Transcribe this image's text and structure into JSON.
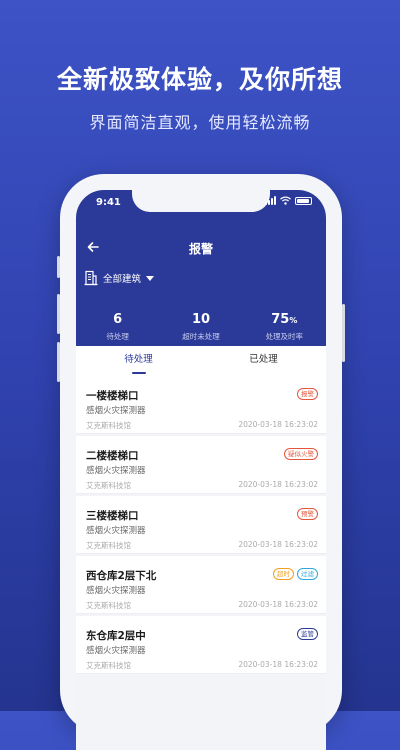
{
  "promo": {
    "headline": "全新极致体验，及你所想",
    "subline": "界面简洁直观，使用轻松流畅"
  },
  "status_bar": {
    "time": "9:41"
  },
  "header": {
    "title": "报警",
    "building_filter": "全部建筑"
  },
  "stats": [
    {
      "value": "6",
      "label": "待处理"
    },
    {
      "value": "10",
      "label": "超时未处理"
    },
    {
      "value": "75",
      "unit": "%",
      "label": "处理及时率"
    }
  ],
  "tabs": [
    {
      "label": "待处理",
      "active": true
    },
    {
      "label": "已处理",
      "active": false
    }
  ],
  "alarms": [
    {
      "title": "一楼楼梯口",
      "device": "感烟火灾探测器",
      "org": "艾克斯科技馆",
      "time": "2020-03-18 16:23:02",
      "badges": [
        {
          "text": "报警",
          "color": "#e4573c"
        }
      ]
    },
    {
      "title": "二楼楼梯口",
      "device": "感烟火灾探测器",
      "org": "艾克斯科技馆",
      "time": "2020-03-18 16:23:02",
      "badges": [
        {
          "text": "疑似火警",
          "color": "#e4573c"
        }
      ]
    },
    {
      "title": "三楼楼梯口",
      "device": "感烟火灾探测器",
      "org": "艾克斯科技馆",
      "time": "2020-03-18 16:23:02",
      "badges": [
        {
          "text": "预警",
          "color": "#e4573c"
        }
      ]
    },
    {
      "title": "西仓库2层下北",
      "device": "感烟火灾探测器",
      "org": "艾克斯科技馆",
      "time": "2020-03-18 16:23:02",
      "badges": [
        {
          "text": "超时",
          "color": "#f0a020"
        },
        {
          "text": "过滤",
          "color": "#2fa7d8"
        }
      ]
    },
    {
      "title": "东仓库2层中",
      "device": "感烟火灾探测器",
      "org": "艾克斯科技馆",
      "time": "2020-03-18 16:23:02",
      "badges": [
        {
          "text": "监管",
          "color": "#2b3a98"
        }
      ]
    }
  ]
}
